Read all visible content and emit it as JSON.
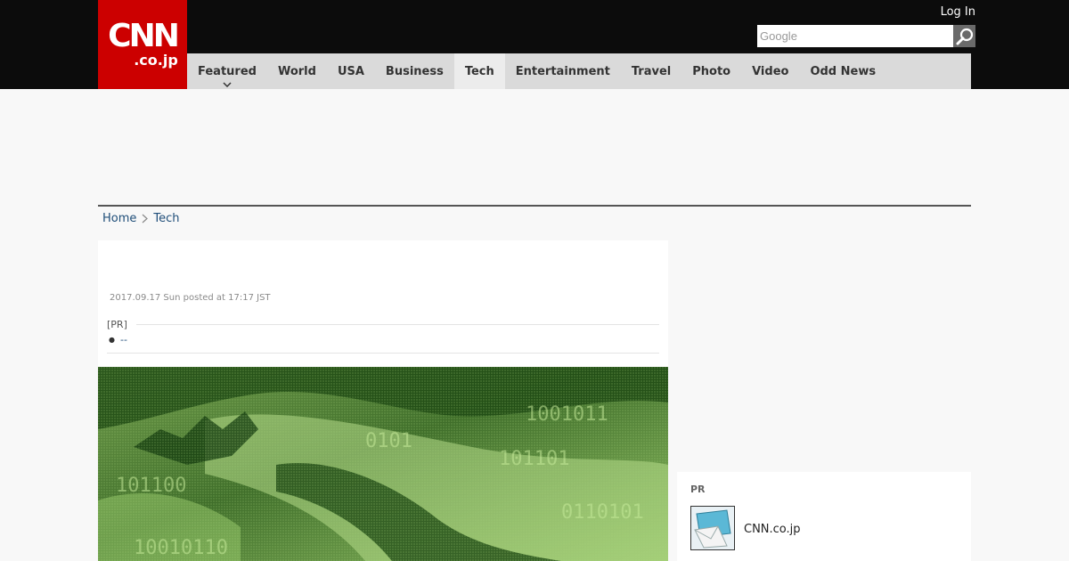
{
  "header": {
    "logo_main": "CNN",
    "logo_sub": ".co.jp",
    "login_label": "Log In",
    "search_placeholder": "Google"
  },
  "nav": {
    "items": [
      {
        "label": "Featured"
      },
      {
        "label": "World"
      },
      {
        "label": "USA"
      },
      {
        "label": "Business"
      },
      {
        "label": "Tech"
      },
      {
        "label": "Entertainment"
      },
      {
        "label": "Travel"
      },
      {
        "label": "Photo"
      },
      {
        "label": "Video"
      },
      {
        "label": "Odd News"
      }
    ],
    "active": "Tech"
  },
  "breadcrumb": {
    "home": "Home",
    "current": "Tech"
  },
  "article": {
    "posted": "2017.09.17 Sun posted at 17:17 JST",
    "pr_label": "[PR]",
    "pr_link": "--"
  },
  "sidebar": {
    "pr_label": "PR",
    "item_text": "CNN.co.jp"
  },
  "colors": {
    "brand": "#cc0000",
    "topbar": "#0c0c0c",
    "nav_bg": "#dadada",
    "link": "#1f4e79"
  }
}
